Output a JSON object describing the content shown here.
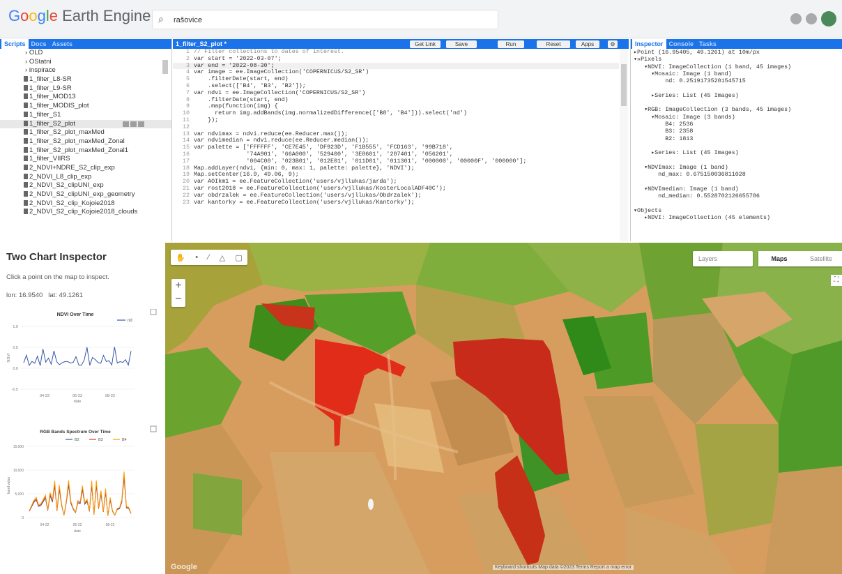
{
  "app": {
    "logo_google": [
      "G",
      "o",
      "o",
      "g",
      "l",
      "e"
    ],
    "logo_rest": " Earth Engine",
    "search_value": "rašovice"
  },
  "left_panel": {
    "tabs": [
      "Scripts",
      "Docs",
      "Assets"
    ],
    "items": [
      {
        "label": "OLD",
        "type": "folder"
      },
      {
        "label": "OStatni",
        "type": "folder"
      },
      {
        "label": "inspirace",
        "type": "folder"
      },
      {
        "label": "1_filter_L8-SR",
        "type": "file"
      },
      {
        "label": "1_filter_L9-SR",
        "type": "file"
      },
      {
        "label": "1_filter_MOD13",
        "type": "file"
      },
      {
        "label": "1_filter_MODIS_plot",
        "type": "file"
      },
      {
        "label": "1_filter_S1",
        "type": "file"
      },
      {
        "label": "1_filter_S2_plot",
        "type": "file",
        "selected": true
      },
      {
        "label": "1_filter_S2_plot_maxMed",
        "type": "file"
      },
      {
        "label": "1_filter_S2_plot_maxMed_Zonal",
        "type": "file"
      },
      {
        "label": "1_filter_S2_plot_maxMed_Zonal1",
        "type": "file"
      },
      {
        "label": "1_filter_VIIRS",
        "type": "file"
      },
      {
        "label": "2_NDVI+NDRE_S2_clip_exp",
        "type": "file"
      },
      {
        "label": "2_NDVI_L8_clip_exp",
        "type": "file"
      },
      {
        "label": "2_NDVI_S2_clipUNI_exp",
        "type": "file"
      },
      {
        "label": "2_NDVI_S2_clipUNI_exp_geometry",
        "type": "file"
      },
      {
        "label": "2_NDVI_S2_clip_Kojoie2018",
        "type": "file"
      },
      {
        "label": "2_NDVI_S2_clip_Kojoie2018_clouds",
        "type": "file"
      }
    ]
  },
  "editor": {
    "tab_name": "1_filter_S2_plot *",
    "buttons": [
      "Get Link",
      "Save",
      "Run",
      "Reset",
      "Apps"
    ],
    "lines": [
      {
        "n": "1",
        "t": "// Filter collections to dates of interest.",
        "c": "cm"
      },
      {
        "n": "2",
        "t": "var start = '2022-03-07';"
      },
      {
        "n": "3",
        "t": "var end = '2022-08-30';",
        "hl": true
      },
      {
        "n": "4",
        "t": "var image = ee.ImageCollection('COPERNICUS/S2_SR')"
      },
      {
        "n": "5",
        "t": "    .filterDate(start, end)"
      },
      {
        "n": "6",
        "t": "    .select(['B4', 'B3', 'B2']);"
      },
      {
        "n": "7",
        "t": "var ndvi = ee.ImageCollection('COPERNICUS/S2_SR')"
      },
      {
        "n": "8",
        "t": "    .filterDate(start, end)"
      },
      {
        "n": "9",
        "t": "    .map(function(img) {"
      },
      {
        "n": "10",
        "t": "      return img.addBands(img.normalizedDifference(['B8', 'B4'])).select('nd')"
      },
      {
        "n": "11",
        "t": "    });"
      },
      {
        "n": "12",
        "t": ""
      },
      {
        "n": "13",
        "t": "var ndvimax = ndvi.reduce(ee.Reducer.max());"
      },
      {
        "n": "14",
        "t": "var ndvimedian = ndvi.reduce(ee.Reducer.median());"
      },
      {
        "n": "15",
        "t": "var palette = ['FFFFFF', 'CE7E45', 'DF923D', 'F1B555', 'FCD163', '99B718',"
      },
      {
        "n": "16",
        "t": "               '74A901', '66A000', '529400', '3E8601', '207401', '056201',"
      },
      {
        "n": "17",
        "t": "               '004C00', '023B01', '012E01', '011D01', '011301', '000000', '00000F', '000000'];"
      },
      {
        "n": "18",
        "t": "Map.addLayer(ndvi, {min: 0, max: 1, palette: palette}, 'NDVI');"
      },
      {
        "n": "19",
        "t": "Map.setCenter(16.9, 49.06, 9);"
      },
      {
        "n": "20",
        "t": "var AOIkm1 = ee.FeatureCollection('users/vjllukas/jarda');"
      },
      {
        "n": "21",
        "t": "var rost2018 = ee.FeatureCollection('users/vjllukas/KosterLocalADF40C');"
      },
      {
        "n": "22",
        "t": "var obdrzalek = ee.FeatureCollection('users/vjllukas/Obdrzalek');"
      },
      {
        "n": "23",
        "t": "var kantorky = ee.FeatureCollection('users/vjllukas/Kantorky');"
      }
    ]
  },
  "inspector": {
    "tabs": [
      "Inspector",
      "Console",
      "Tasks"
    ],
    "lines": [
      "▸Point (16.95405, 49.1261) at 10m/px",
      "▾»Pixels",
      "   ▾NDVI: ImageCollection (1 band, 45 images)",
      "     ▾Mosaic: Image (1 band)",
      "         nd: 0.25191735201545715",
      "",
      "     ▸Series: List (45 Images)",
      "",
      "   ▾RGB: ImageCollection (3 bands, 45 images)",
      "     ▾Mosaic: Image (3 bands)",
      "         B4: 2536",
      "         B3: 2358",
      "         B2: 1813",
      "",
      "     ▸Series: List (45 Images)",
      "",
      "   ▾NDVImax: Image (1 band)",
      "       nd_max: 0.675150036811028",
      "",
      "   ▾NDVImedian: Image (1 band)",
      "       nd_median: 0.5528702126655786",
      "",
      "▾Objects",
      "   ▸NDVI: ImageCollection (45 elements)"
    ]
  },
  "chart_panel": {
    "title": "Two Chart Inspector",
    "instruction": "Click a point on the map to inspect.",
    "lon_label": "lon: 16.9540",
    "lat_label": "lat: 49.1261",
    "chart1": {
      "title": "NDVI Over Time",
      "legend": "nd",
      "ylabel": "NDVI",
      "xlabel": "date",
      "yticks": [
        "1.0",
        "0.5",
        "0.0",
        "-0.5"
      ],
      "xticks": [
        "04-22",
        "06-22",
        "08-22"
      ]
    },
    "chart2": {
      "title": "RGB Bands Spectrum Over Time",
      "legend": [
        "B2",
        "B3",
        "B4"
      ],
      "ylabel": "band value",
      "xlabel": "date",
      "yticks": [
        "15,000",
        "10,000",
        "5,000",
        "0"
      ],
      "xticks": [
        "04-22",
        "06-22",
        "08-22"
      ]
    }
  },
  "map": {
    "layers_label": "Layers",
    "map_types": [
      "Maps",
      "Satellite"
    ],
    "zoom_in": "+",
    "zoom_out": "−",
    "watermark": "Google",
    "footer": "Keyboard shortcuts  Map data ©2023  Terms  Report a map error"
  },
  "colors": {
    "accent": "#1a73e8",
    "field_red": "#d83a1e",
    "ndvi_green": "#3f8c1a",
    "ndvi_orange": "#d69d5f"
  }
}
